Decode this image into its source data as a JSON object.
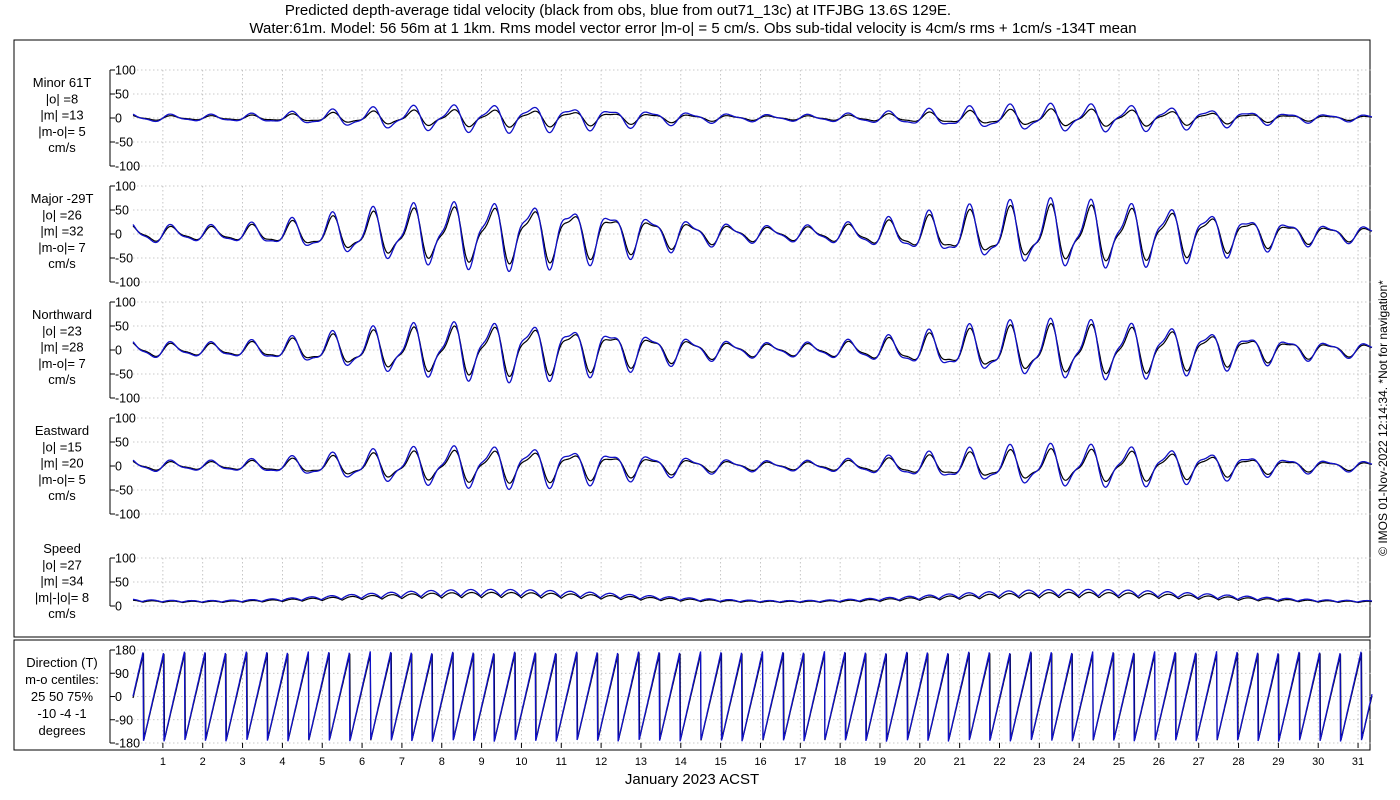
{
  "title": {
    "line1": "Predicted depth-average tidal velocity (black from obs, blue from out71_13c) at ITFJBG 13.6S 129E.",
    "line2": "Water:61m. Model: 56 56m at 1 1km. Rms model vector error |m-o| = 5 cm/s. Obs sub-tidal velocity is 4cm/s rms + 1cm/s -134T mean"
  },
  "credit": "© IMOS 01-Nov-2022 12:14:34. *Not for navigation*",
  "colors": {
    "observed": "#000000",
    "model": "#1010c8",
    "grid": "#b8b8b8"
  },
  "chart_data": {
    "type": "line",
    "xlabel": "January 2023 ACST",
    "x_ticks": [
      "1",
      "2",
      "3",
      "4",
      "5",
      "6",
      "7",
      "8",
      "9",
      "10",
      "11",
      "12",
      "13",
      "14",
      "15",
      "16",
      "17",
      "18",
      "19",
      "20",
      "21",
      "22",
      "23",
      "24",
      "25",
      "26",
      "27",
      "28",
      "29",
      "30",
      "31"
    ],
    "xlim": [
      0.25,
      31.35
    ],
    "grid": true,
    "series_legend": [
      {
        "name": "black from obs",
        "color": "#000000"
      },
      {
        "name": "blue from out71_13c",
        "color": "#1010c8"
      }
    ],
    "panels": [
      {
        "key": "minor",
        "label_lines": [
          "Minor 61T",
          "|o| =8",
          "|m| =13",
          "|m-o|= 5",
          "cm/s"
        ],
        "yticks": [
          "100",
          "50",
          "0",
          "-50",
          "-100"
        ],
        "ylim": [
          -100,
          100
        ],
        "obs_amplitude": 8,
        "model_amplitude": 13,
        "wave": "velocity"
      },
      {
        "key": "major",
        "label_lines": [
          "Major -29T",
          "|o| =26",
          "|m| =32",
          "|m-o|= 7",
          "cm/s"
        ],
        "yticks": [
          "100",
          "50",
          "0",
          "-50",
          "-100"
        ],
        "ylim": [
          -100,
          100
        ],
        "obs_amplitude": 26,
        "model_amplitude": 32,
        "wave": "velocity"
      },
      {
        "key": "northward",
        "label_lines": [
          "Northward",
          "|o| =23",
          "|m| =28",
          "|m-o|= 7",
          "cm/s"
        ],
        "yticks": [
          "100",
          "50",
          "0",
          "-50",
          "-100"
        ],
        "ylim": [
          -100,
          100
        ],
        "obs_amplitude": 23,
        "model_amplitude": 28,
        "wave": "velocity"
      },
      {
        "key": "eastward",
        "label_lines": [
          "Eastward",
          "|o| =15",
          "|m| =20",
          "|m-o|= 5",
          "cm/s"
        ],
        "yticks": [
          "100",
          "50",
          "0",
          "-50",
          "-100"
        ],
        "ylim": [
          -100,
          100
        ],
        "obs_amplitude": 15,
        "model_amplitude": 20,
        "wave": "velocity"
      },
      {
        "key": "speed",
        "label_lines": [
          "Speed",
          "|o| =27",
          "|m| =34",
          "|m|-|o|= 8",
          "cm/s"
        ],
        "yticks": [
          "100",
          "50",
          "0"
        ],
        "ylim": [
          0,
          100
        ],
        "obs_amplitude": 27,
        "model_amplitude": 34,
        "wave": "speed"
      },
      {
        "key": "direction",
        "label_lines": [
          "Direction (T)",
          "m-o centiles:",
          "25  50  75%",
          "-10  -4  -1",
          "degrees"
        ],
        "yticks": [
          "180",
          "90",
          "0",
          "-90",
          "-180"
        ],
        "ylim": [
          -180,
          180
        ],
        "wave": "direction"
      }
    ]
  }
}
